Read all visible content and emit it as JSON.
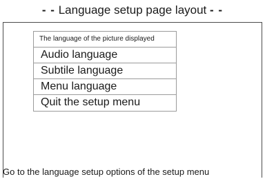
{
  "header": {
    "dash_left": "- -",
    "title": "Language setup page layout",
    "dash_right": "- -"
  },
  "menu": {
    "header_label": "The language of the picture displayed",
    "items": [
      {
        "label": "Audio language"
      },
      {
        "label": "Subtile language"
      },
      {
        "label": "Menu language"
      },
      {
        "label": "Quit the setup menu"
      }
    ]
  },
  "status": {
    "text": "Go to the language setup options of the setup menu"
  },
  "colors": {
    "background": "#ffffff",
    "text": "#1a1a1a",
    "frame_border": "#4a4a4a",
    "menu_border": "#9a9a9a"
  }
}
